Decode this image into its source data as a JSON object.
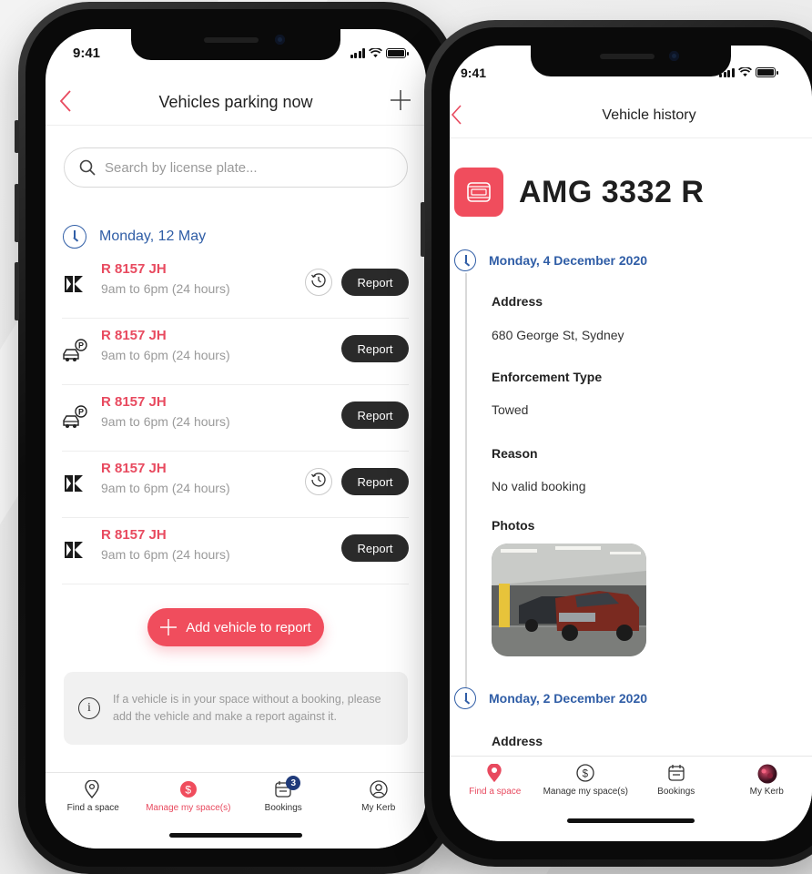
{
  "left": {
    "status": {
      "time": "9:41"
    },
    "header": {
      "title": "Vehicles parking now",
      "back_icon": "chevron-left-icon",
      "add_icon": "plus-icon"
    },
    "search": {
      "placeholder": "Search by license plate..."
    },
    "date": "Monday, 12 May",
    "vehicles": [
      {
        "plate": "R 8157 JH",
        "time": "9am to 6pm (24 hours)",
        "icon": "kerb-logo-icon",
        "history": true,
        "report": "Report"
      },
      {
        "plate": "R 8157 JH",
        "time": "9am to 6pm (24 hours)",
        "icon": "car-parking-icon",
        "history": false,
        "report": "Report"
      },
      {
        "plate": "R 8157 JH",
        "time": "9am to 6pm (24 hours)",
        "icon": "car-parking-icon",
        "history": false,
        "report": "Report"
      },
      {
        "plate": "R 8157 JH",
        "time": "9am to 6pm (24 hours)",
        "icon": "kerb-logo-icon",
        "history": true,
        "report": "Report"
      },
      {
        "plate": "R 8157 JH",
        "time": "9am to 6pm (24 hours)",
        "icon": "kerb-logo-icon",
        "history": false,
        "report": "Report"
      }
    ],
    "add_button": "Add vehicle to report",
    "info": "If a vehicle is in your space without a booking, please add the vehicle and make a report against it.",
    "tabs": [
      {
        "label": "Find a space",
        "icon": "location-pin-icon",
        "active": false
      },
      {
        "label": "Manage my space(s)",
        "icon": "dollar-circle-icon",
        "active": true
      },
      {
        "label": "Bookings",
        "icon": "calendar-icon",
        "active": false,
        "badge": "3"
      },
      {
        "label": "My Kerb",
        "icon": "user-icon",
        "active": false
      }
    ]
  },
  "right": {
    "status": {
      "time": "9:41"
    },
    "header": {
      "title": "Vehicle history",
      "back_icon": "chevron-left-icon"
    },
    "plate": "AMG 3332 R",
    "entries": [
      {
        "date": "Monday, 4 December 2020",
        "address_label": "Address",
        "address": "680 George St, Sydney",
        "enforcement_label": "Enforcement Type",
        "enforcement": "Towed",
        "reason_label": "Reason",
        "reason": "No valid booking",
        "photos_label": "Photos"
      },
      {
        "date": "Monday, 2 December 2020",
        "address_label": "Address"
      }
    ],
    "tabs": [
      {
        "label": "Find a space",
        "icon": "location-pin-icon",
        "active": true
      },
      {
        "label": "Manage my space(s)",
        "icon": "dollar-circle-icon",
        "active": false
      },
      {
        "label": "Bookings",
        "icon": "calendar-icon",
        "active": false
      },
      {
        "label": "My Kerb",
        "icon": "avatar",
        "active": false
      }
    ]
  },
  "colors": {
    "accent": "#f04d5d",
    "date_blue": "#2f5da6",
    "dark_button": "#2a2a2a",
    "badge_navy": "#1f3a7a"
  }
}
